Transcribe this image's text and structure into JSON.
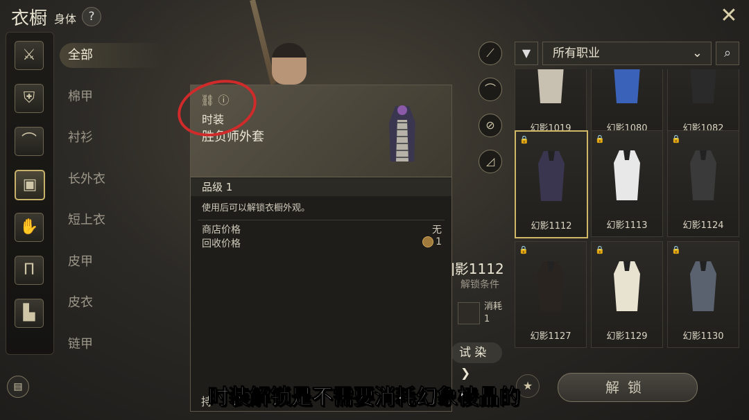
{
  "header": {
    "title": "衣橱",
    "subtitle": "身体",
    "help": "?",
    "close": "✕"
  },
  "rail": [
    {
      "name": "weapon-icon",
      "glyph": "⚔",
      "active": false
    },
    {
      "name": "shield-icon",
      "glyph": "⛨",
      "active": false
    },
    {
      "name": "hat-icon",
      "glyph": "⌒",
      "active": false
    },
    {
      "name": "armor-icon",
      "glyph": "▣",
      "active": true
    },
    {
      "name": "glove-icon",
      "glyph": "✋",
      "active": false
    },
    {
      "name": "pants-icon",
      "glyph": "Π",
      "active": false
    },
    {
      "name": "boots-icon",
      "glyph": "▙",
      "active": false
    }
  ],
  "categories": [
    "全部",
    "棉甲",
    "衬衫",
    "长外衣",
    "短上衣",
    "皮甲",
    "皮衣",
    "链甲"
  ],
  "tooltip": {
    "type": "时装",
    "name": "胜负师外套",
    "grade": "品级 1",
    "desc": "使用后可以解锁衣橱外观。",
    "shop_price_label": "商店价格",
    "shop_price": "无",
    "recycle_label": "回收价格",
    "recycle_value": "1",
    "bottom_partial": "持"
  },
  "detail": {
    "name_partial": "]影1112",
    "unlock_condition": "解锁条件",
    "consume_label": "消耗",
    "consume_count": "1",
    "dye_label": "试 染",
    "dye_arrow": "❯"
  },
  "filter": {
    "job": "所有职业",
    "chevron": "⌄"
  },
  "grid": [
    {
      "label": "幻影1019",
      "locked": false,
      "selected": false
    },
    {
      "label": "幻影1080",
      "locked": false,
      "selected": false
    },
    {
      "label": "幻影1082",
      "locked": false,
      "selected": false
    },
    {
      "label": "幻影1112",
      "locked": true,
      "selected": true
    },
    {
      "label": "幻影1113",
      "locked": true,
      "selected": false
    },
    {
      "label": "幻影1124",
      "locked": true,
      "selected": false
    },
    {
      "label": "幻影1127",
      "locked": true,
      "selected": false
    },
    {
      "label": "幻影1129",
      "locked": true,
      "selected": false
    },
    {
      "label": "幻影1130",
      "locked": true,
      "selected": false
    }
  ],
  "unlock_button": "解锁",
  "caption": "时装解锁是不需要消耗幻象棱晶的",
  "colors": {
    "accent": "#d1b866",
    "annotation": "#d02a2a"
  }
}
